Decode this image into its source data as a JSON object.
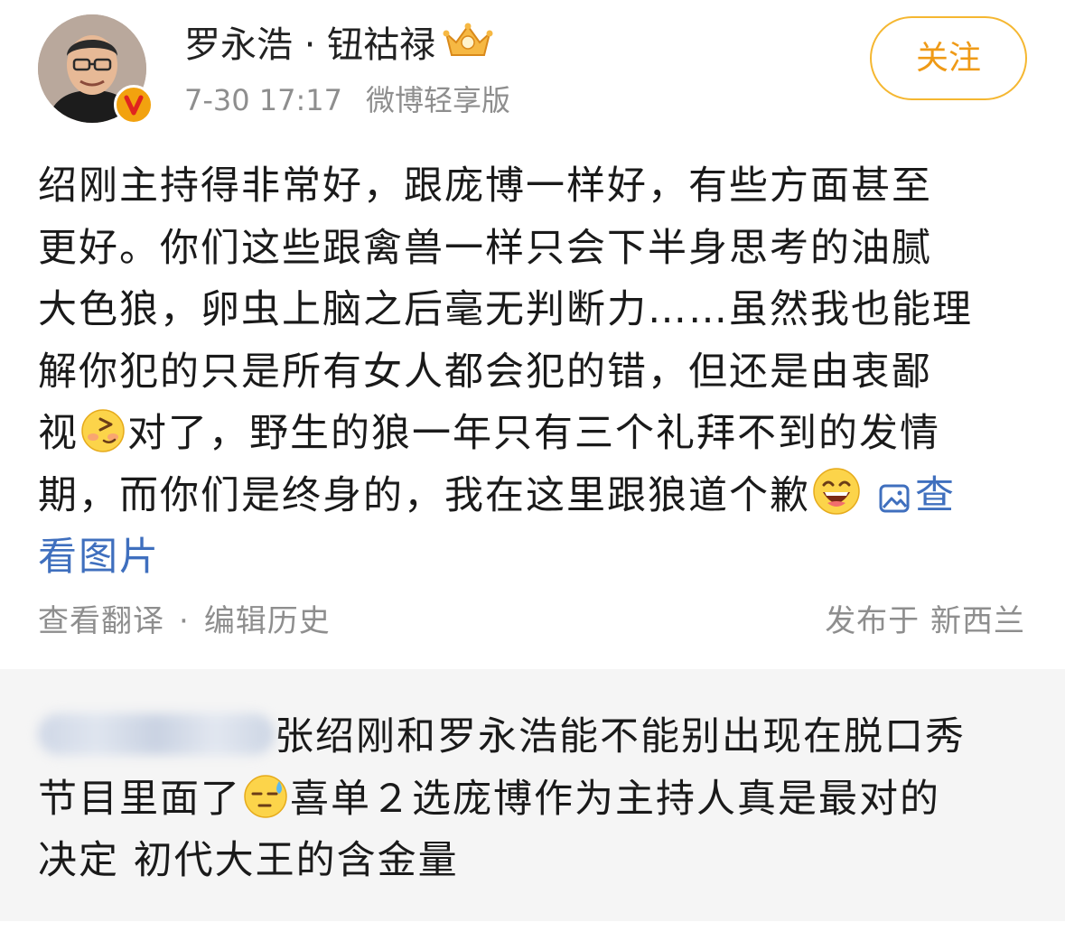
{
  "post": {
    "author_name": "罗永浩 · 钮祜禄",
    "timestamp": "7-30 17:17",
    "source": "微博轻享版",
    "follow_label": "关注",
    "lines": [
      "绍刚主持得非常好，跟庞博一样好，有些方面甚至",
      "更好。你们这些跟禽兽一样只会下半身思考的油腻",
      "大色狼，卵虫上脑之后毫无判断力……虽然我也能理",
      "解你犯的只是所有女人都会犯的错，但还是由衷鄙"
    ],
    "line5_a": "视",
    "line5_b": "对了，野生的狼一年只有三个礼拜不到的发情",
    "line6": "期，而你们是终身的，我在这里跟狼道个歉",
    "view_image_a": "查",
    "view_image_b": "看图片",
    "translate_label": "查看翻译",
    "separator": "·",
    "edit_history_label": "编辑历史",
    "location": "发布于 新西兰"
  },
  "comment": {
    "line1": "张绍刚和罗永浩能不能别出现在脱口秀",
    "line2_a": "节目里面了",
    "line2_b": "喜单２选庞博作为主持人真是最对的",
    "line3": "决定 初代大王的含金量"
  },
  "icons": {
    "badge": "verified-v-icon",
    "crown": "crown-icon",
    "emoji1": "smug-emoji",
    "emoji2": "laughing-emoji",
    "emoji3": "sweat-emoji",
    "photo": "image-icon"
  },
  "colors": {
    "follow": "#ef9a16",
    "badge": "#f2a20f",
    "link": "#3f6fbe",
    "meta": "#8e8e8e",
    "comment_bg": "#f5f5f5"
  }
}
